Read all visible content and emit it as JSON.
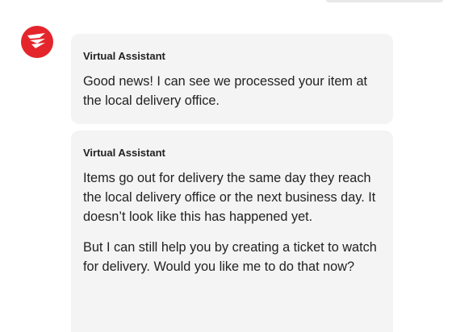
{
  "brand": {
    "accent_color": "#e4252b",
    "avatar_icon": "canada-post-logo-icon"
  },
  "messages": [
    {
      "sender": "Virtual Assistant",
      "paragraphs": [
        "Good news! I can see we processed your item at the local delivery office."
      ]
    },
    {
      "sender": "Virtual Assistant",
      "paragraphs": [
        "Items go out for delivery the same day they reach the local delivery office or the next business day. It doesn’t look like this has happened yet.",
        "But I can still help you by creating a ticket to watch for delivery. Would you like me to do that now?"
      ]
    }
  ]
}
